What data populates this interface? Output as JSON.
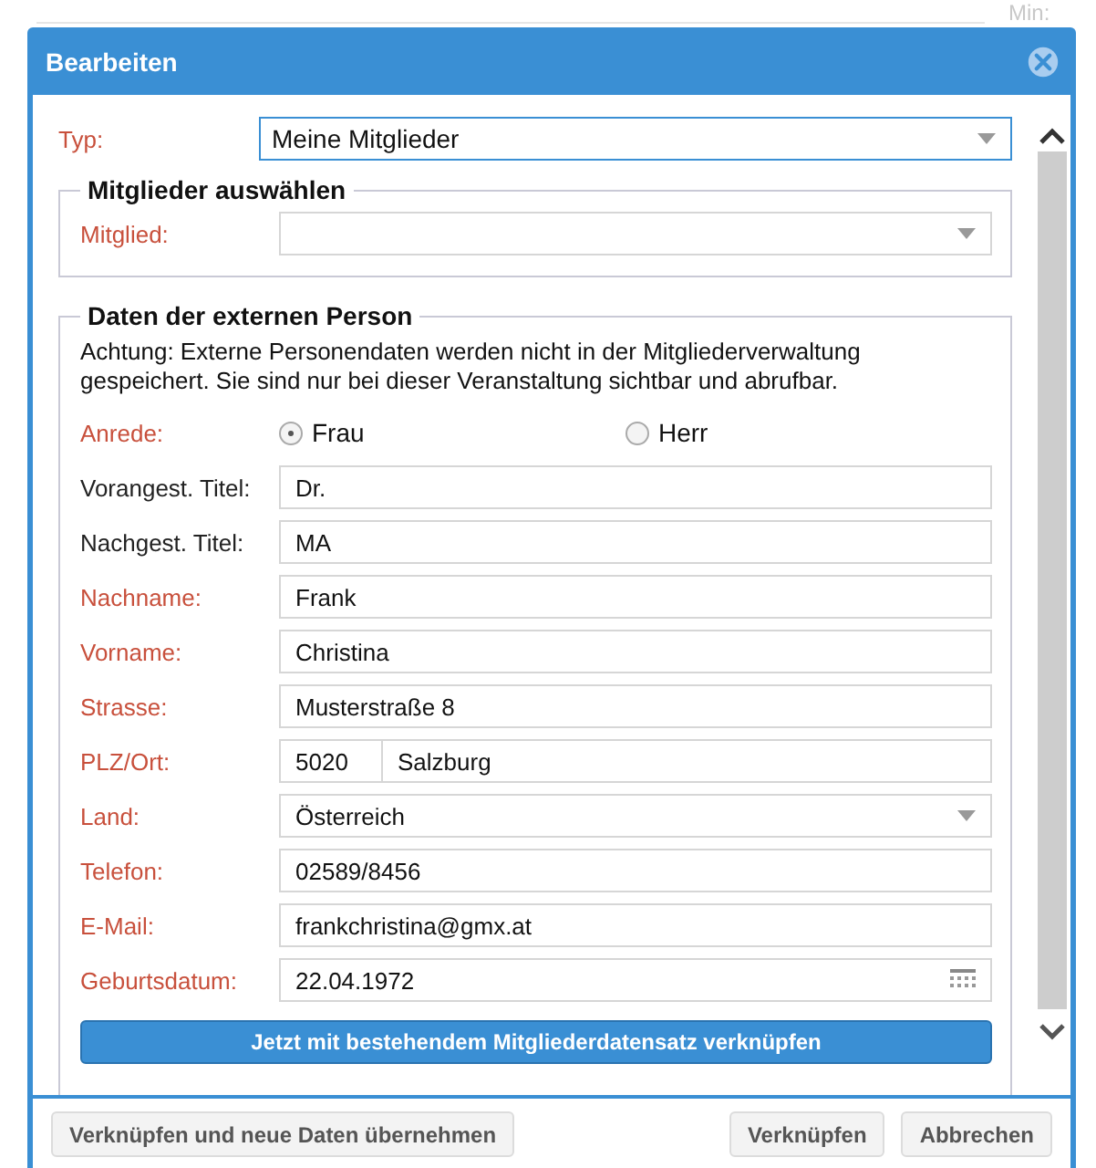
{
  "background": {
    "label": "Min:"
  },
  "dialog": {
    "title": "Bearbeiten"
  },
  "typ": {
    "label": "Typ:",
    "required": true,
    "value": "Meine Mitglieder",
    "focused": true
  },
  "member_section": {
    "legend": "Mitglieder auswählen",
    "label": "Mitglied:",
    "required": true
  },
  "external_section": {
    "legend": "Daten der externen Person",
    "notice": "Achtung: Externe Personendaten werden nicht in der Mitgliederverwaltung gespeichert. Sie sind nur bei dieser Veranstaltung sichtbar und abrufbar.",
    "salutation": {
      "label": "Anrede:",
      "required": true,
      "options": [
        {
          "label": "Frau",
          "selected": true
        },
        {
          "label": "Herr",
          "selected": false
        }
      ]
    },
    "fields": [
      {
        "kind": "text",
        "label": "Vorangest. Titel:",
        "required": false,
        "value": "Dr."
      },
      {
        "kind": "text",
        "label": "Nachgest. Titel:",
        "required": false,
        "value": "MA"
      },
      {
        "kind": "text",
        "label": "Nachname:",
        "required": true,
        "value": "Frank"
      },
      {
        "kind": "text",
        "label": "Vorname:",
        "required": true,
        "value": "Christina"
      },
      {
        "kind": "text",
        "label": "Strasse:",
        "required": true,
        "value": "Musterstraße 8"
      },
      {
        "kind": "zip_city",
        "label": "PLZ/Ort:",
        "required": true,
        "zip": "5020",
        "city": "Salzburg"
      },
      {
        "kind": "select",
        "label": "Land:",
        "required": true,
        "value": "Österreich"
      },
      {
        "kind": "text",
        "label": "Telefon:",
        "required": true,
        "value": "02589/8456"
      },
      {
        "kind": "text",
        "label": "E-Mail:",
        "required": true,
        "value": "frankchristina@gmx.at"
      },
      {
        "kind": "date",
        "label": "Geburtsdatum:",
        "required": true,
        "value": "22.04.1972"
      }
    ],
    "link_button": "Jetzt mit bestehendem Mitgliederdatensatz verknüpfen"
  },
  "footer": {
    "left_button": "Verknüpfen und neue Daten übernehmen",
    "right_buttons": [
      "Verknüpfen",
      "Abbrechen"
    ]
  }
}
